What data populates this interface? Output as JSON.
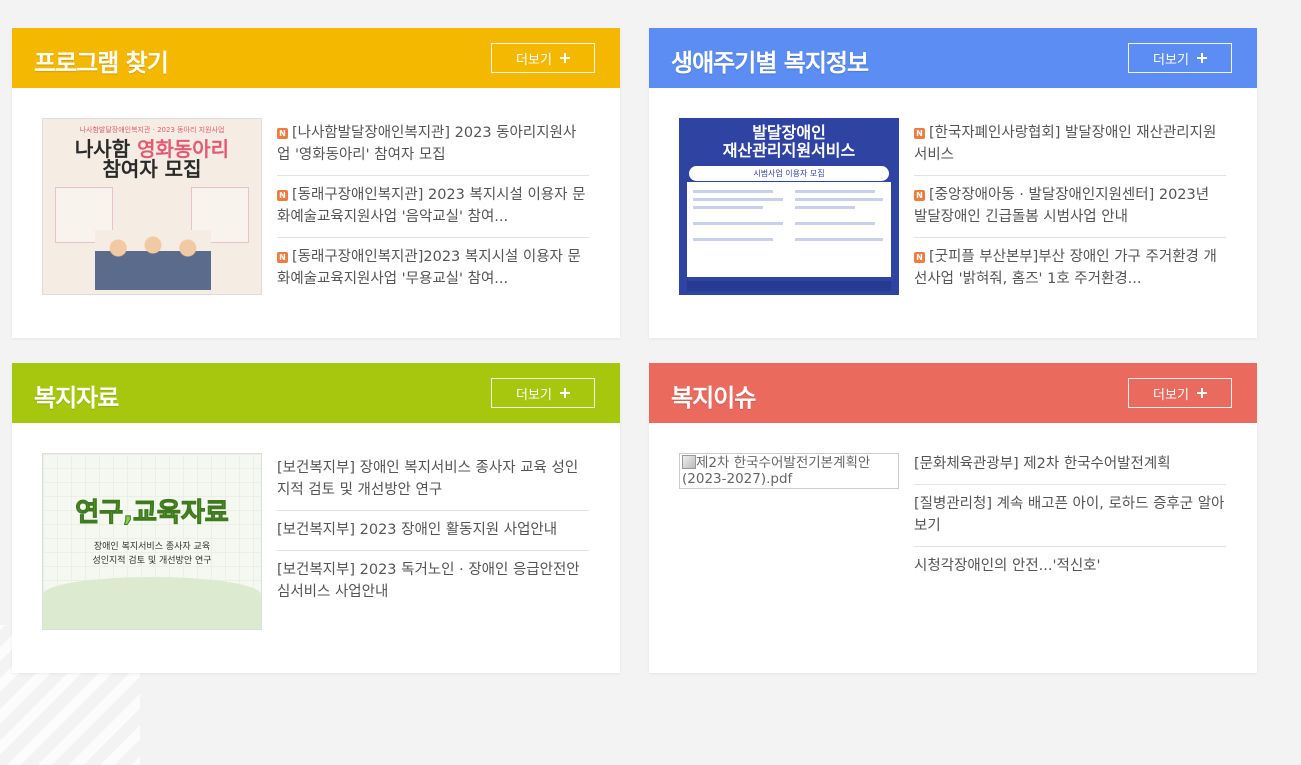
{
  "colors": {
    "programs": "#f5b800",
    "lifecycle": "#5b8df2",
    "materials": "#a6c70e",
    "issues": "#ea6a5e"
  },
  "more_label": "더보기",
  "programs": {
    "title": "프로그램 찾기",
    "thumb": {
      "top": "나사함발달장애인복지관 · 2023 동아리 지원사업",
      "head1": "나사함",
      "head2": "영화동아리",
      "head3": "참여자 모집"
    },
    "items": [
      {
        "label": "[나사함발달장애인복지관] 2023 동아리지원사업 '영화동아리' 참여자 모집",
        "icon": "new-icon"
      },
      {
        "label": "[동래구장애인복지관] 2023 복지시설 이용자 문화예술교육지원사업 '음악교실' 참여...",
        "icon": "new-icon"
      },
      {
        "label": "[동래구장애인복지관]2023 복지시설 이용자 문화예술교육지원사업 '무용교실' 참여...",
        "icon": "new-icon"
      }
    ]
  },
  "lifecycle": {
    "title": "생애주기별 복지정보",
    "thumb": {
      "head1": "발달장애인",
      "head2": "재산관리지원서비스",
      "sub": "시범사업 이용자 모집"
    },
    "items": [
      {
        "label": "[한국자폐인사랑협회] 발달장애인 재산관리지원서비스",
        "icon": "new-icon"
      },
      {
        "label": "[중앙장애아동 · 발달장애인지원센터] 2023년 발달장애인 긴급돌봄 시범사업 안내",
        "icon": "new-icon"
      },
      {
        "label": "[굿피플 부산본부]부산 장애인 가구 주거환경 개선사업 '밝혀줘, 홈즈' 1호 주거환경...",
        "icon": "new-icon"
      }
    ]
  },
  "materials": {
    "title": "복지자료",
    "thumb": {
      "head": "연구,교육자료",
      "line1": "장애인 복지서비스 종사자 교육",
      "line2": "성인지적 검토 및 개선방안 연구"
    },
    "items": [
      {
        "label": "[보건복지부] 장애인 복지서비스 종사자 교육 성인지적 검토 및 개선방안 연구"
      },
      {
        "label": "[보건복지부] 2023 장애인 활동지원 사업안내"
      },
      {
        "label": "[보건복지부] 2023 독거노인 · 장애인 응급안전안심서비스 사업안내"
      }
    ]
  },
  "issues": {
    "title": "복지이슈",
    "thumb_alt": "제2차 한국수어발전기본계획안(2023-2027).pdf",
    "items": [
      {
        "label": "[문화체육관광부] 제2차 한국수어발전계획"
      },
      {
        "label": "[질병관리청] 계속 배고픈 아이, 로하드 증후군 알아보기"
      },
      {
        "label": "시청각장애인의 안전...'적신호'"
      }
    ]
  }
}
